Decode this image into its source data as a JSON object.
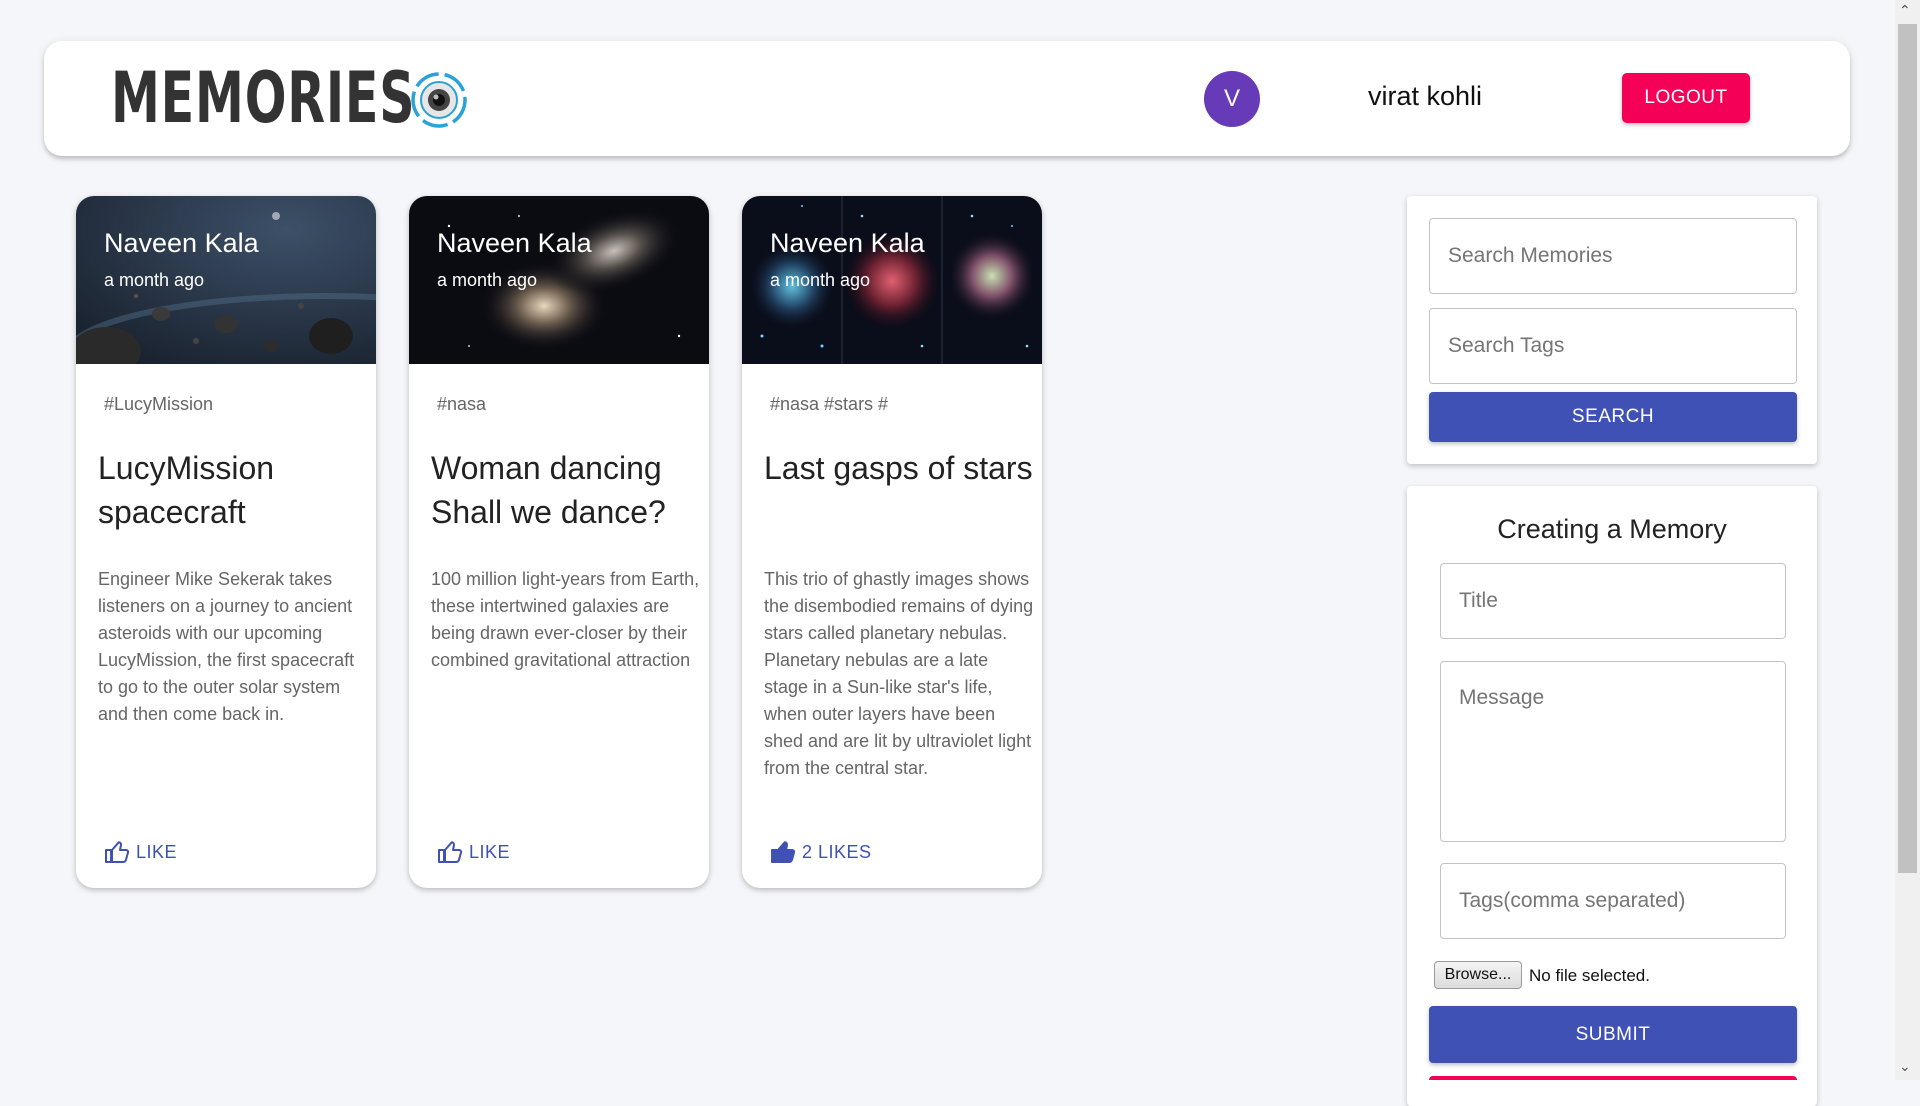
{
  "header": {
    "logo_text": "MEMORIES",
    "logo_icon": "camera-lens-icon",
    "avatar_initial": "V",
    "username": "virat kohli",
    "logout_label": "LOGOUT",
    "colors": {
      "avatar": "#673ab7",
      "logout": "#f50057"
    }
  },
  "posts": [
    {
      "author": "Naveen Kala",
      "time": "a month ago",
      "tags": "#LucyMission",
      "title": "LucyMission spacecraft",
      "message": "Engineer Mike Sekerak takes listeners on a journey to ancient asteroids with our upcoming LucyMission, the first spacecraft to go to the outer solar system and then come back in.",
      "like_label": "LIKE"
    },
    {
      "author": "Naveen Kala",
      "time": "a month ago",
      "tags": "#nasa",
      "title": "Woman dancing Shall we dance?",
      "message": "100 million light-years from Earth, these intertwined galaxies are being drawn ever-closer by their combined gravitational attraction",
      "like_label": "LIKE"
    },
    {
      "author": "Naveen Kala",
      "time": "a month ago",
      "tags": "#nasa #stars #",
      "title": "Last gasps of stars",
      "message": "This trio of ghastly images shows the disembodied remains of dying stars called planetary nebulas. Planetary nebulas are a late stage in a Sun-like star's life, when outer layers have been shed and are lit by ultraviolet light from the central star.",
      "like_label": "2 LIKES"
    }
  ],
  "search": {
    "memories_placeholder": "Search Memories",
    "tags_placeholder": "Search Tags",
    "button_label": "SEARCH"
  },
  "form": {
    "title": "Creating a Memory",
    "title_placeholder": "Title",
    "message_placeholder": "Message",
    "tags_placeholder": "Tags(comma separated)",
    "browse_label": "Browse...",
    "file_status": "No file selected.",
    "submit_label": "SUBMIT"
  },
  "theme": {
    "primary": "#3f51b5",
    "secondary": "#f50057",
    "background": "#f5f6fa"
  }
}
